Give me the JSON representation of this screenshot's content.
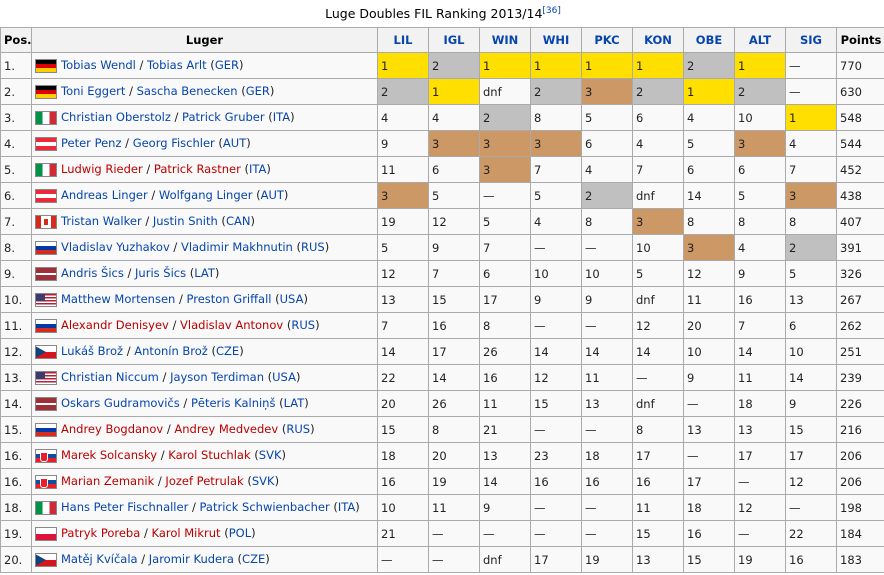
{
  "table": {
    "caption": "Luge Doubles FIL Ranking 2013/14",
    "ref": "[36]",
    "headers": {
      "pos": "Pos.",
      "luger": "Luger",
      "races": [
        "LIL",
        "IGL",
        "WIN",
        "WHI",
        "PKC",
        "KON",
        "OBE",
        "ALT",
        "SIG"
      ],
      "points": "Points"
    },
    "rows": [
      {
        "pos": "1.",
        "flag": "ger",
        "p1": "Tobias Wendl",
        "p1c": "l",
        "p2": "Tobias Arlt",
        "p2c": "l",
        "cc": "GER",
        "r": [
          "1",
          "2",
          "1",
          "1",
          "1",
          "1",
          "2",
          "1",
          "—"
        ],
        "m": [
          "g",
          "s",
          "g",
          "g",
          "g",
          "g",
          "s",
          "g",
          ""
        ],
        "pts": "770"
      },
      {
        "pos": "2.",
        "flag": "ger",
        "p1": "Toni Eggert",
        "p1c": "l",
        "p2": "Sascha Benecken",
        "p2c": "l",
        "cc": "GER",
        "r": [
          "2",
          "1",
          "dnf",
          "2",
          "3",
          "2",
          "1",
          "2",
          "—"
        ],
        "m": [
          "s",
          "g",
          "",
          "s",
          "b",
          "s",
          "g",
          "s",
          ""
        ],
        "pts": "630"
      },
      {
        "pos": "3.",
        "flag": "ita",
        "p1": "Christian Oberstolz",
        "p1c": "l",
        "p2": "Patrick Gruber",
        "p2c": "l",
        "cc": "ITA",
        "r": [
          "4",
          "4",
          "2",
          "8",
          "5",
          "6",
          "4",
          "10",
          "1"
        ],
        "m": [
          "",
          "",
          "s",
          "",
          "",
          "",
          "",
          "",
          "g"
        ],
        "pts": "548"
      },
      {
        "pos": "4.",
        "flag": "aut",
        "p1": "Peter Penz",
        "p1c": "l",
        "p2": "Georg Fischler",
        "p2c": "l",
        "cc": "AUT",
        "r": [
          "9",
          "3",
          "3",
          "3",
          "6",
          "4",
          "5",
          "3",
          "4"
        ],
        "m": [
          "",
          "b",
          "b",
          "b",
          "",
          "",
          "",
          "b",
          ""
        ],
        "pts": "544"
      },
      {
        "pos": "5.",
        "flag": "ita",
        "p1": "Ludwig Rieder",
        "p1c": "r",
        "p2": "Patrick Rastner",
        "p2c": "r",
        "cc": "ITA",
        "r": [
          "11",
          "6",
          "3",
          "7",
          "4",
          "7",
          "6",
          "6",
          "7"
        ],
        "m": [
          "",
          "",
          "b",
          "",
          "",
          "",
          "",
          "",
          ""
        ],
        "pts": "452"
      },
      {
        "pos": "6.",
        "flag": "aut",
        "p1": "Andreas Linger",
        "p1c": "l",
        "p2": "Wolfgang Linger",
        "p2c": "l",
        "cc": "AUT",
        "r": [
          "3",
          "5",
          "—",
          "5",
          "2",
          "dnf",
          "14",
          "5",
          "3"
        ],
        "m": [
          "b",
          "",
          "",
          "",
          "s",
          "",
          "",
          "",
          "b"
        ],
        "pts": "438"
      },
      {
        "pos": "7.",
        "flag": "can",
        "p1": "Tristan Walker",
        "p1c": "l",
        "p2": "Justin Snith",
        "p2c": "l",
        "cc": "CAN",
        "r": [
          "19",
          "12",
          "5",
          "4",
          "8",
          "3",
          "8",
          "8",
          "8"
        ],
        "m": [
          "",
          "",
          "",
          "",
          "",
          "b",
          "",
          "",
          ""
        ],
        "pts": "407"
      },
      {
        "pos": "8.",
        "flag": "rus",
        "p1": "Vladislav Yuzhakov",
        "p1c": "l",
        "p2": "Vladimir Makhnutin",
        "p2c": "l",
        "cc": "RUS",
        "r": [
          "5",
          "9",
          "7",
          "—",
          "—",
          "10",
          "3",
          "4",
          "2"
        ],
        "m": [
          "",
          "",
          "",
          "",
          "",
          "",
          "b",
          "",
          "s"
        ],
        "pts": "391"
      },
      {
        "pos": "9.",
        "flag": "lat",
        "p1": "Andris Šics",
        "p1c": "l",
        "p2": "Juris Šics",
        "p2c": "l",
        "cc": "LAT",
        "r": [
          "12",
          "7",
          "6",
          "10",
          "10",
          "5",
          "12",
          "9",
          "5"
        ],
        "m": [
          "",
          "",
          "",
          "",
          "",
          "",
          "",
          "",
          ""
        ],
        "pts": "326"
      },
      {
        "pos": "10.",
        "flag": "usa",
        "p1": "Matthew Mortensen",
        "p1c": "l",
        "p2": "Preston Griffall",
        "p2c": "l",
        "cc": "USA",
        "r": [
          "13",
          "15",
          "17",
          "9",
          "9",
          "dnf",
          "11",
          "16",
          "13"
        ],
        "m": [
          "",
          "",
          "",
          "",
          "",
          "",
          "",
          "",
          ""
        ],
        "pts": "267"
      },
      {
        "pos": "11.",
        "flag": "rus",
        "p1": "Alexandr Denisyev",
        "p1c": "r",
        "p2": "Vladislav Antonov",
        "p2c": "r",
        "cc": "RUS",
        "r": [
          "7",
          "16",
          "8",
          "—",
          "—",
          "12",
          "20",
          "7",
          "6"
        ],
        "m": [
          "",
          "",
          "",
          "",
          "",
          "",
          "",
          "",
          ""
        ],
        "pts": "262"
      },
      {
        "pos": "12.",
        "flag": "cze",
        "p1": "Lukáš Brož",
        "p1c": "l",
        "p2": "Antonín Brož",
        "p2c": "l",
        "cc": "CZE",
        "r": [
          "14",
          "17",
          "26",
          "14",
          "14",
          "14",
          "10",
          "14",
          "10"
        ],
        "m": [
          "",
          "",
          "",
          "",
          "",
          "",
          "",
          "",
          ""
        ],
        "pts": "251"
      },
      {
        "pos": "13.",
        "flag": "usa",
        "p1": "Christian Niccum",
        "p1c": "l",
        "p2": "Jayson Terdiman",
        "p2c": "l",
        "cc": "USA",
        "r": [
          "22",
          "14",
          "16",
          "12",
          "11",
          "—",
          "9",
          "11",
          "14"
        ],
        "m": [
          "",
          "",
          "",
          "",
          "",
          "",
          "",
          "",
          ""
        ],
        "pts": "239"
      },
      {
        "pos": "14.",
        "flag": "lat",
        "p1": "Oskars Gudramovičs",
        "p1c": "l",
        "p2": "Pēteris Kalniņš",
        "p2c": "l",
        "cc": "LAT",
        "r": [
          "20",
          "26",
          "11",
          "15",
          "13",
          "dnf",
          "—",
          "18",
          "9"
        ],
        "m": [
          "",
          "",
          "",
          "",
          "",
          "",
          "",
          "",
          ""
        ],
        "pts": "226"
      },
      {
        "pos": "15.",
        "flag": "rus",
        "p1": "Andrey Bogdanov",
        "p1c": "r",
        "p2": "Andrey Medvedev",
        "p2c": "r",
        "cc": "RUS",
        "r": [
          "15",
          "8",
          "21",
          "—",
          "—",
          "8",
          "13",
          "13",
          "15"
        ],
        "m": [
          "",
          "",
          "",
          "",
          "",
          "",
          "",
          "",
          ""
        ],
        "pts": "216"
      },
      {
        "pos": "16.",
        "flag": "svk",
        "p1": "Marek Solcansky",
        "p1c": "r",
        "p2": "Karol Stuchlak",
        "p2c": "r",
        "cc": "SVK",
        "r": [
          "18",
          "20",
          "13",
          "23",
          "18",
          "17",
          "—",
          "17",
          "17"
        ],
        "m": [
          "",
          "",
          "",
          "",
          "",
          "",
          "",
          "",
          ""
        ],
        "pts": "206"
      },
      {
        "pos": "16.",
        "flag": "svk",
        "p1": "Marian Zemanik",
        "p1c": "r",
        "p2": "Jozef Petrulak",
        "p2c": "r",
        "cc": "SVK",
        "r": [
          "16",
          "19",
          "14",
          "16",
          "16",
          "16",
          "17",
          "—",
          "12"
        ],
        "m": [
          "",
          "",
          "",
          "",
          "",
          "",
          "",
          "",
          ""
        ],
        "pts": "206"
      },
      {
        "pos": "18.",
        "flag": "ita",
        "p1": "Hans Peter Fischnaller",
        "p1c": "l",
        "p2": "Patrick Schwienbacher",
        "p2c": "l",
        "cc": "ITA",
        "r": [
          "10",
          "11",
          "9",
          "—",
          "—",
          "11",
          "18",
          "12",
          "—"
        ],
        "m": [
          "",
          "",
          "",
          "",
          "",
          "",
          "",
          "",
          ""
        ],
        "pts": "198"
      },
      {
        "pos": "19.",
        "flag": "pol",
        "p1": "Patryk Poreba",
        "p1c": "r",
        "p2": "Karol Mikrut",
        "p2c": "r",
        "cc": "POL",
        "r": [
          "21",
          "—",
          "—",
          "—",
          "—",
          "15",
          "16",
          "—",
          "22"
        ],
        "m": [
          "",
          "",
          "",
          "",
          "",
          "",
          "",
          "",
          ""
        ],
        "pts": "184"
      },
      {
        "pos": "20.",
        "flag": "cze",
        "p1": "Matěj Kvíčala",
        "p1c": "l",
        "p2": "Jaromir Kudera",
        "p2c": "l",
        "cc": "CZE",
        "r": [
          "—",
          "—",
          "dnf",
          "17",
          "19",
          "13",
          "15",
          "19",
          "16"
        ],
        "m": [
          "",
          "",
          "",
          "",
          "",
          "",
          "",
          "",
          ""
        ],
        "pts": "183"
      }
    ]
  }
}
